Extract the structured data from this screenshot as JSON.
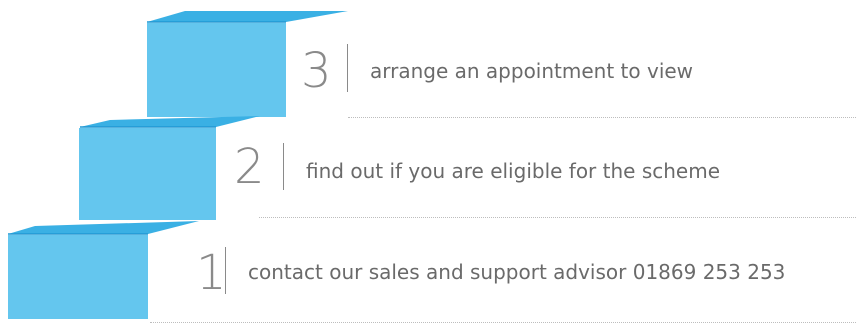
{
  "colors": {
    "block": "#64c6ee",
    "block_top": "#3ab0e4",
    "block_edge": "#1f97d4",
    "text": "#6a6a6a",
    "number": "#8a8a8a"
  },
  "steps": [
    {
      "number": "1",
      "text": "contact our sales and support advisor 01869 253 253"
    },
    {
      "number": "2",
      "text": "find out if you are eligible for the scheme"
    },
    {
      "number": "3",
      "text": "arrange an appointment to view"
    }
  ]
}
